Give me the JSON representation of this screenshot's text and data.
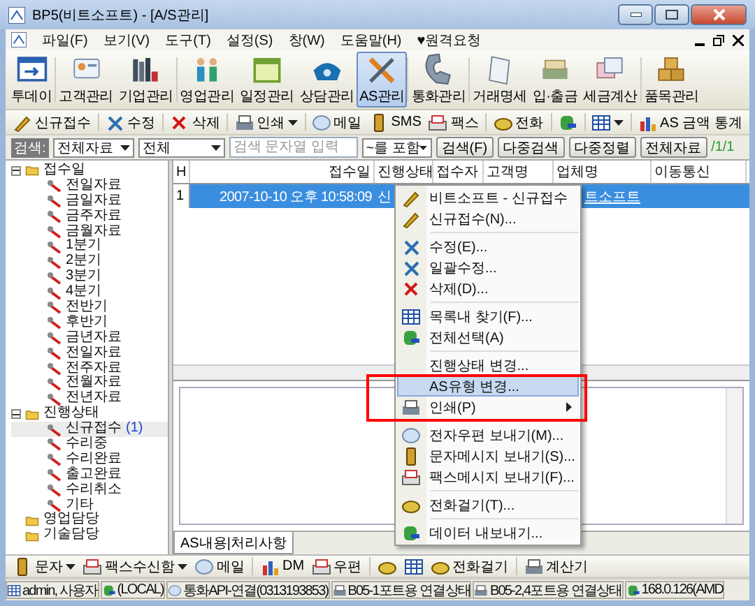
{
  "window": {
    "title": "BP5(비트소프트) - [A/S관리]"
  },
  "menubar": [
    "파일(F)",
    "보기(V)",
    "도구(T)",
    "설정(S)",
    "창(W)",
    "도움말(H)",
    "♥원격요청"
  ],
  "main_toolbar": [
    {
      "label": "투데이",
      "selected": false
    },
    {
      "label": "고객관리",
      "selected": false
    },
    {
      "label": "기업관리",
      "selected": false
    },
    {
      "label": "영업관리",
      "selected": false
    },
    {
      "label": "일정관리",
      "selected": false
    },
    {
      "label": "상담관리",
      "selected": false
    },
    {
      "label": "AS관리",
      "selected": true
    },
    {
      "label": "통화관리",
      "selected": false
    },
    {
      "label": "거래명세",
      "selected": false
    },
    {
      "label": "입·출금",
      "selected": false
    },
    {
      "label": "세금계산",
      "selected": false
    },
    {
      "label": "품목관리",
      "selected": false
    }
  ],
  "action_toolbar": [
    {
      "kind": "button",
      "label": "신규접수"
    },
    {
      "kind": "separator"
    },
    {
      "kind": "button",
      "label": "수정"
    },
    {
      "kind": "separator"
    },
    {
      "kind": "button",
      "label": "삭제"
    },
    {
      "kind": "separator"
    },
    {
      "kind": "dropdown",
      "label": "인쇄"
    },
    {
      "kind": "separator"
    },
    {
      "kind": "button",
      "label": "메일"
    },
    {
      "kind": "button",
      "label": "SMS"
    },
    {
      "kind": "button",
      "label": "팩스"
    },
    {
      "kind": "separator"
    },
    {
      "kind": "button",
      "label": "전화"
    },
    {
      "kind": "separator"
    },
    {
      "kind": "icon"
    },
    {
      "kind": "separator"
    },
    {
      "kind": "icon_dropdown"
    },
    {
      "kind": "separator"
    },
    {
      "kind": "button",
      "label": "AS 금액 통계"
    }
  ],
  "search_bar": {
    "label": "검색:",
    "scope": "전체자료",
    "field": "전체",
    "placeholder": "검색 문자열 입력",
    "match": "~를 포함",
    "buttons": [
      "검색(F)",
      "다중검색",
      "다중정렬",
      "전체자료"
    ],
    "page": "/1/1"
  },
  "tree": [
    {
      "label": "접수일",
      "expanded": true,
      "selected": false,
      "children": [
        {
          "label": "전일자료",
          "selected": false
        },
        {
          "label": "금일자료",
          "selected": false
        },
        {
          "label": "금주자료",
          "selected": false
        },
        {
          "label": "금월자료",
          "selected": false
        },
        {
          "label": "1분기",
          "selected": false
        },
        {
          "label": "2분기",
          "selected": false
        },
        {
          "label": "3분기",
          "selected": false
        },
        {
          "label": "4분기",
          "selected": false
        },
        {
          "label": "전반기",
          "selected": false
        },
        {
          "label": "후반기",
          "selected": false
        },
        {
          "label": "금년자료",
          "selected": false
        },
        {
          "label": "전일자료",
          "selected": false
        },
        {
          "label": "전주자료",
          "selected": false
        },
        {
          "label": "전월자료",
          "selected": false
        },
        {
          "label": "전년자료",
          "selected": false
        }
      ]
    },
    {
      "label": "진행상태",
      "expanded": true,
      "selected": false,
      "children": [
        {
          "label": "신규접수",
          "count": "(1)",
          "selected": true
        },
        {
          "label": "수리중",
          "selected": false
        },
        {
          "label": "수리완료",
          "selected": false
        },
        {
          "label": "출고완료",
          "selected": false
        },
        {
          "label": "수리취소",
          "selected": false
        },
        {
          "label": "기타",
          "selected": false
        }
      ]
    },
    {
      "label": "영업담당",
      "selected": false
    },
    {
      "label": "기술담당",
      "selected": false
    }
  ],
  "table": {
    "columns": [
      "H",
      "접수일",
      "진행상태",
      "접수자",
      "고객명",
      "업체명",
      "이동통신"
    ],
    "rows": [
      {
        "number": "1",
        "received": "2007-10-10 오후 10:58:09",
        "status": "신",
        "company": "트소프트",
        "selected": true
      }
    ]
  },
  "detail_tabs": [
    {
      "label": "AS내용|처리사항",
      "selected": true
    }
  ],
  "context_menu": {
    "items": [
      {
        "kind": "header",
        "label": "비트소프트 - 신규접수",
        "selected": false
      },
      {
        "kind": "item",
        "label": "신규접수(N)...",
        "selected": false
      },
      {
        "kind": "separator"
      },
      {
        "kind": "item",
        "label": "수정(E)...",
        "selected": false
      },
      {
        "kind": "item",
        "label": "일괄수정...",
        "selected": false
      },
      {
        "kind": "item",
        "label": "삭제(D)...",
        "selected": false
      },
      {
        "kind": "separator"
      },
      {
        "kind": "item",
        "label": "목록내 찾기(F)...",
        "selected": false
      },
      {
        "kind": "item",
        "label": "전체선택(A)",
        "selected": false
      },
      {
        "kind": "separator"
      },
      {
        "kind": "item",
        "label": "진행상태 변경...",
        "selected": false
      },
      {
        "kind": "item",
        "label": "AS유형 변경...",
        "selected": true
      },
      {
        "kind": "submenu",
        "label": "인쇄(P)",
        "selected": false
      },
      {
        "kind": "separator"
      },
      {
        "kind": "item",
        "label": "전자우편 보내기(M)...",
        "selected": false
      },
      {
        "kind": "item",
        "label": "문자메시지 보내기(S)...",
        "selected": false
      },
      {
        "kind": "item",
        "label": "팩스메시지 보내기(F)...",
        "selected": false
      },
      {
        "kind": "separator"
      },
      {
        "kind": "item",
        "label": "전화걸기(T)...",
        "selected": false
      },
      {
        "kind": "separator"
      },
      {
        "kind": "item",
        "label": "데이터 내보내기...",
        "selected": false
      }
    ]
  },
  "bottom_toolbar": [
    {
      "kind": "dropdown",
      "label": "문자"
    },
    {
      "kind": "dropdown",
      "label": "팩스수신함"
    },
    {
      "kind": "button",
      "label": "메일"
    },
    {
      "kind": "separator"
    },
    {
      "kind": "button",
      "label": "DM"
    },
    {
      "kind": "button",
      "label": "우편"
    },
    {
      "kind": "separator"
    },
    {
      "kind": "icon"
    },
    {
      "kind": "icon"
    },
    {
      "kind": "button",
      "label": "전화걸기"
    },
    {
      "kind": "separator"
    },
    {
      "kind": "button",
      "label": "계산기"
    }
  ],
  "status_bar": [
    "admin, 사용자",
    "(LOCAL)",
    "통화API-연결(0313193853)",
    "B05-1포트용 연결상태",
    "B05-2,4포트용 연결상태",
    "168.0.126(AMD"
  ]
}
